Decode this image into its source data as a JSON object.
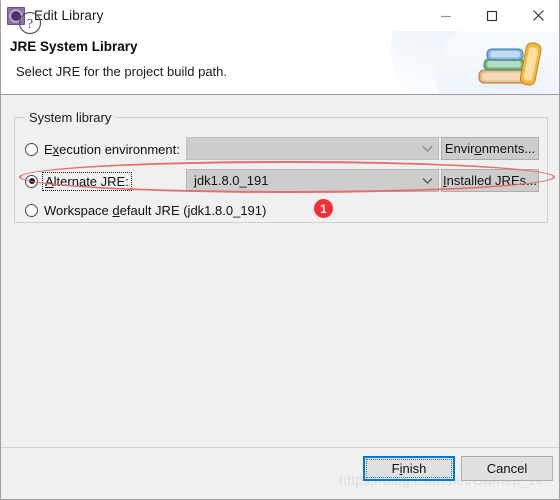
{
  "window": {
    "title": "Edit Library",
    "icon": "library-gear-icon",
    "controls": {
      "minimize": "minimize-icon",
      "maximize": "maximize-icon",
      "close": "close-icon"
    }
  },
  "header": {
    "title": "JRE System Library",
    "subtitle": "Select JRE for the project build path.",
    "icon": "books-stack-icon"
  },
  "group": {
    "legend": "System library",
    "options": [
      {
        "id": "execution-environment",
        "label_pre": "E",
        "label_mnemonic": "x",
        "label_post": "ecution environment:",
        "full_label": "Execution environment:",
        "selected": false,
        "focused": false,
        "combo": {
          "value": "",
          "disabled": true,
          "arrow": "chevron-down-icon"
        },
        "button": {
          "pre": "Envir",
          "mnemonic": "o",
          "post": "nments...",
          "full": "Environments..."
        }
      },
      {
        "id": "alternate-jre",
        "label_pre": "",
        "label_mnemonic": "A",
        "label_post": "lternate JRE:",
        "full_label": "Alternate JRE:",
        "selected": true,
        "focused": true,
        "combo": {
          "value": "jdk1.8.0_191",
          "disabled": false,
          "arrow": "chevron-down-icon"
        },
        "button": {
          "pre": "",
          "mnemonic": "I",
          "post": "nstalled JREs...",
          "full": "Installed JREs..."
        }
      },
      {
        "id": "workspace-default-jre",
        "label_pre": "Workspace ",
        "label_mnemonic": "d",
        "label_post": "efault JRE (jdk1.8.0_191)",
        "full_label": "Workspace default JRE (jdk1.8.0_191)",
        "selected": false,
        "focused": false
      }
    ]
  },
  "annotation": {
    "badge_number": "1",
    "highlight_target": "alternate-jre-row",
    "color": "#ea6b6b",
    "badge_color": "#f02f36"
  },
  "footer": {
    "help_icon": "question-mark-icon",
    "finish": {
      "pre": "F",
      "mnemonic": "i",
      "post": "nish",
      "full": "Finish",
      "is_default": true
    },
    "cancel": {
      "full": "Cancel"
    },
    "watermark": "https://blog.csdn.net/Garnett_zk"
  }
}
